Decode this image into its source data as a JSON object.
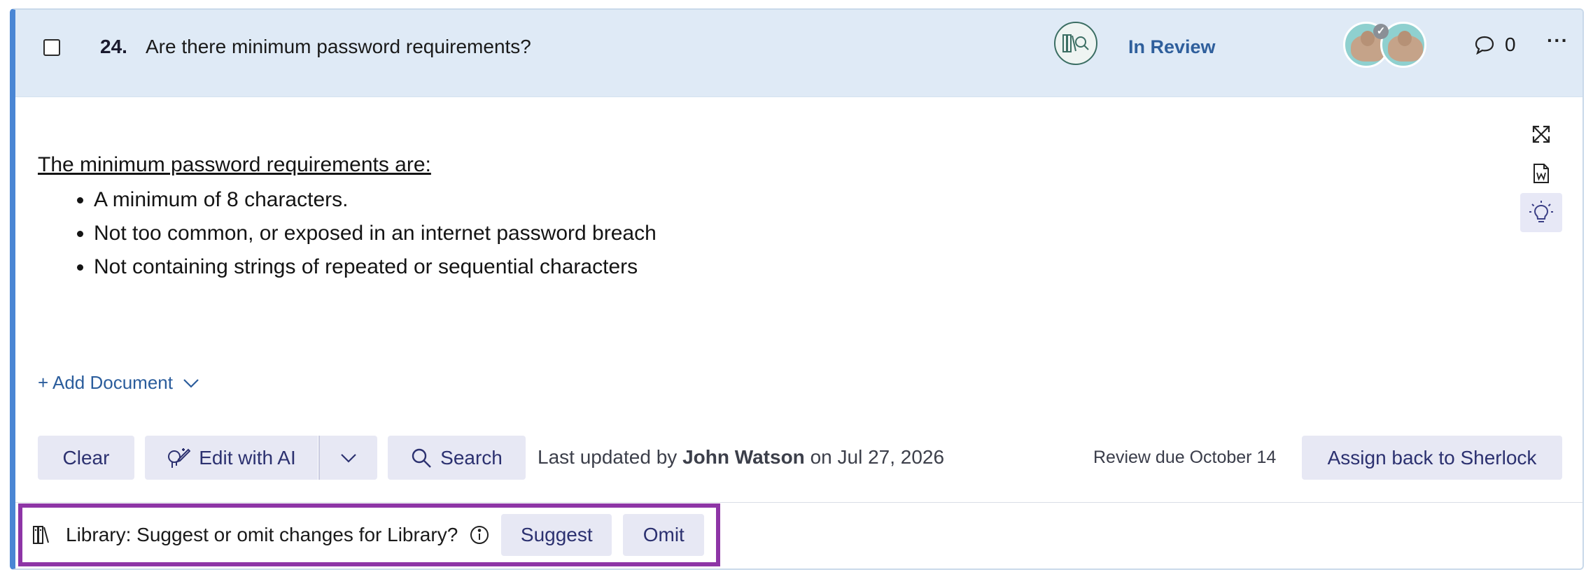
{
  "question": {
    "number": "24.",
    "text": "Are there minimum password requirements?",
    "status": "In Review",
    "comment_count": "0",
    "more_label": "···"
  },
  "answer": {
    "lead": "The minimum password requirements are:",
    "bullets": [
      "A minimum of 8 characters.",
      "Not too common, or exposed in an internet password breach",
      "Not containing strings of repeated or sequential characters"
    ]
  },
  "add_document_label": "+ Add Document",
  "toolbar": {
    "clear_label": "Clear",
    "edit_ai_label": "Edit with AI",
    "search_label": "Search",
    "updated_prefix": "Last updated by",
    "updated_user": "John Watson",
    "updated_suffix": "on Jul 27, 2026",
    "review_due": "Review due October 14",
    "assign_label": "Assign back to Sherlock"
  },
  "library": {
    "prompt": "Library: Suggest or omit changes for Library?",
    "suggest_label": "Suggest",
    "omit_label": "Omit"
  },
  "icons": {
    "library_search": "library-search-icon",
    "comment": "comment-icon",
    "expand": "expand-icon",
    "word_doc": "word-document-icon",
    "lightbulb": "lightbulb-icon",
    "edit_ai": "ai-edit-icon",
    "search": "search-icon",
    "library": "library-books-icon",
    "info": "info-icon"
  },
  "colors": {
    "accent_border": "#4a86d4",
    "header_bg": "#dfeaf6",
    "status": "#2f5f9c",
    "button_bg": "#e7e8f4",
    "button_text": "#2c3170",
    "highlight": "#8e35a6"
  }
}
